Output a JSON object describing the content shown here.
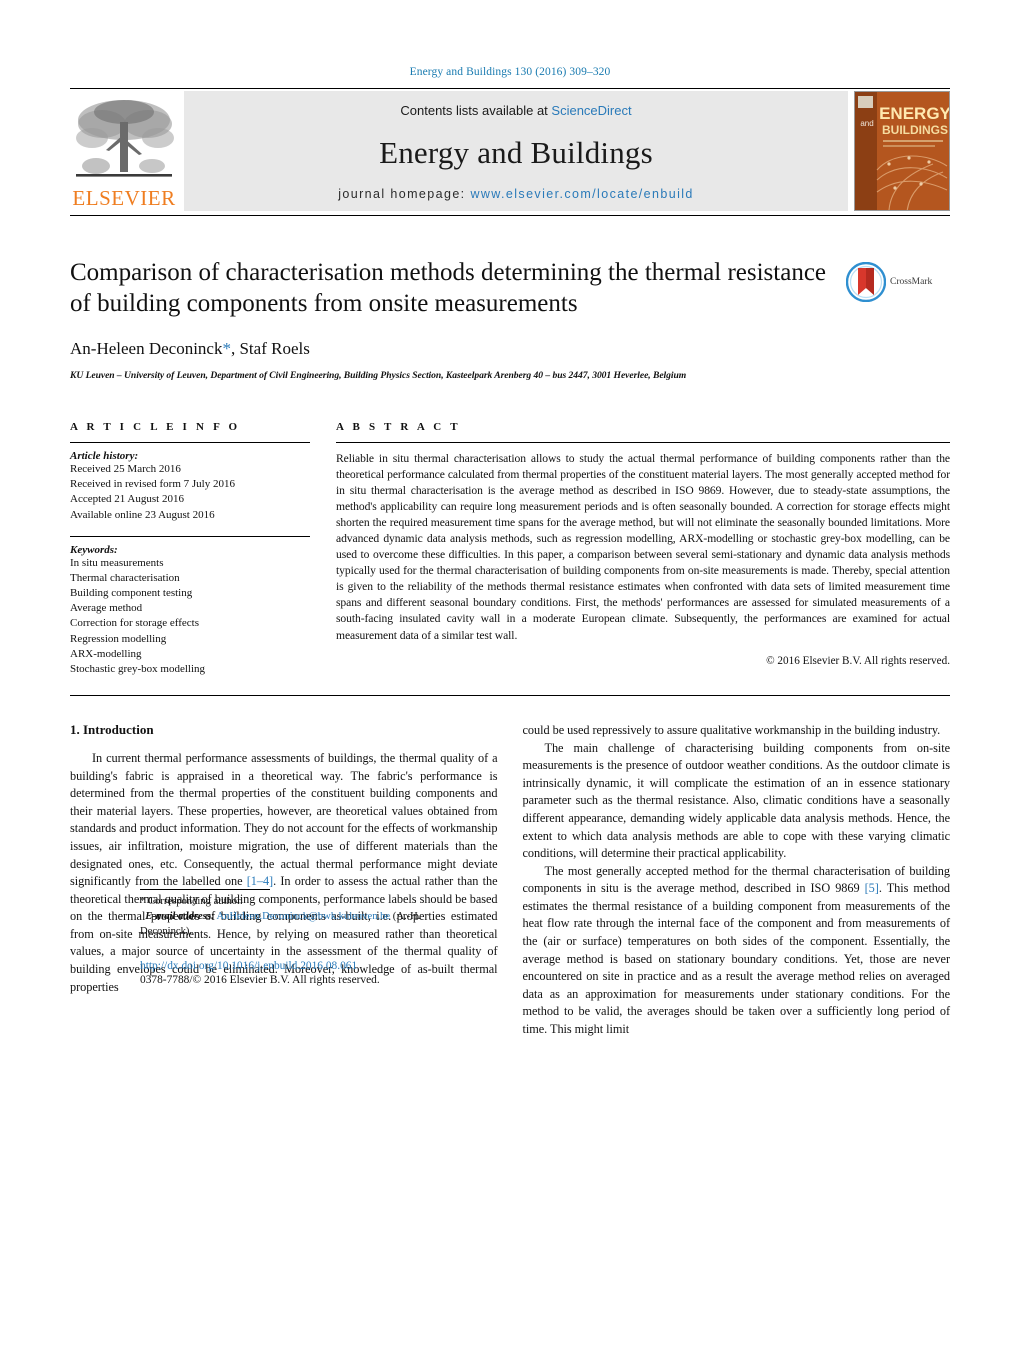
{
  "running_head": "Energy and Buildings 130 (2016) 309–320",
  "masthead": {
    "publisher_name": "ELSEVIER",
    "contents_prefix": "Contents lists available at ",
    "contents_link": "ScienceDirect",
    "journal_name": "Energy and Buildings",
    "homepage_prefix": "journal homepage: ",
    "homepage_url": "www.elsevier.com/locate/enbuild",
    "cover_title_top": "ENERGY",
    "cover_title_and": "and",
    "cover_title_bottom": "BUILDINGS"
  },
  "article": {
    "title": "Comparison of characterisation methods determining the thermal resistance of building components from onsite measurements",
    "authors": "An-Heleen Deconinck",
    "corresponding_marker": "*",
    "authors_rest": ", Staf Roels",
    "affiliation": "KU Leuven – University of Leuven, Department of Civil Engineering, Building Physics Section, Kasteelpark Arenberg 40 – bus 2447, 3001 Heverlee, Belgium",
    "crossmark_label": "CrossMark"
  },
  "article_info": {
    "heading": "A R T I C L E   I N F O",
    "history_label": "Article history:",
    "history": [
      "Received 25 March 2016",
      "Received in revised form 7 July 2016",
      "Accepted 21 August 2016",
      "Available online 23 August 2016"
    ],
    "keywords_label": "Keywords:",
    "keywords": [
      "In situ measurements",
      "Thermal characterisation",
      "Building component testing",
      "Average method",
      "Correction for storage effects",
      "Regression modelling",
      "ARX-modelling",
      "Stochastic grey-box modelling"
    ]
  },
  "abstract": {
    "heading": "A B S T R A C T",
    "text": "Reliable in situ thermal characterisation allows to study the actual thermal performance of building components rather than the theoretical performance calculated from thermal properties of the constituent material layers. The most generally accepted method for in situ thermal characterisation is the average method as described in ISO 9869. However, due to steady-state assumptions, the method's applicability can require long measurement periods and is often seasonally bounded. A correction for storage effects might shorten the required measurement time spans for the average method, but will not eliminate the seasonally bounded limitations. More advanced dynamic data analysis methods, such as regression modelling, ARX-modelling or stochastic grey-box modelling, can be used to overcome these difficulties. In this paper, a comparison between several semi-stationary and dynamic data analysis methods typically used for the thermal characterisation of building components from on-site measurements is made. Thereby, special attention is given to the reliability of the methods thermal resistance estimates when confronted with data sets of limited measurement time spans and different seasonal boundary conditions. First, the methods' performances are assessed for simulated measurements of a south-facing insulated cavity wall in a moderate European climate. Subsequently, the performances are examined for actual measurement data of a similar test wall.",
    "copyright": "© 2016 Elsevier B.V. All rights reserved."
  },
  "introduction": {
    "number_title": "1.  Introduction",
    "left_para_1a": "In current thermal performance assessments of buildings, the thermal quality of a building's fabric is appraised in a theoretical way. The fabric's performance is determined from the thermal properties of the constituent building components and their material layers. These properties, however, are theoretical values obtained from standards and product information. They do not account for the effects of workmanship issues, air infiltration, moisture migration, the use of different materials than the designated ones, etc. Consequently, the actual thermal performance might deviate significantly from the labelled one ",
    "left_ref_1": "[1–4]",
    "left_para_1b": ". In order to assess the actual rather than the theoretical thermal quality of building components, performance labels should be based on the thermal properties of building components as-built, i.e. properties estimated from on-site measurements. Hence, by relying on measured rather than theoretical values, a major source of uncertainty in the assessment of the thermal quality of building envelopes could be eliminated. Moreover, knowledge of as-built thermal properties",
    "right_para_1_cont": "could be used repressively to assure qualitative workmanship in the building industry.",
    "right_para_2": "The main challenge of characterising building components from on-site measurements is the presence of outdoor weather conditions. As the outdoor climate is intrinsically dynamic, it will complicate the estimation of an in essence stationary parameter such as the thermal resistance. Also, climatic conditions have a seasonally different appearance, demanding widely applicable data analysis methods. Hence, the extent to which data analysis methods are able to cope with these varying climatic conditions, will determine their practical applicability.",
    "right_para_3a": "The most generally accepted method for the thermal characterisation of building components in situ is the average method, described in ISO 9869 ",
    "right_ref_5": "[5]",
    "right_para_3b": ". This method estimates the thermal resistance of a building component from measurements of the heat flow rate through the internal face of the component and from measurements of the (air or surface) temperatures on both sides of the component. Essentially, the average method is based on stationary boundary conditions. Yet, those are never encountered on site in practice and as a result the average method relies on averaged data as an approximation for measurements under stationary conditions. For the method to be valid, the averages should be taken over a sufficiently long period of time. This might limit"
  },
  "footer": {
    "corresponding_star": "*",
    "corresponding_label": "Corresponding author.",
    "email_label": "E-mail address:",
    "email": "AnHeleen.Deconinck@bwk.kuleuven.be",
    "email_suffix": "(A.-H. Deconinck).",
    "doi": "http://dx.doi.org/10.1016/j.enbuild.2016.08.061",
    "issn_copyright": "0378-7788/© 2016 Elsevier B.V. All rights reserved."
  },
  "colors": {
    "link_blue": "#2a7ab9",
    "running_head_blue": "#1a7bb0",
    "elsevier_orange": "#ef7d20",
    "masthead_grey": "#e8e8e8",
    "cover_orange": "#b4561f"
  }
}
